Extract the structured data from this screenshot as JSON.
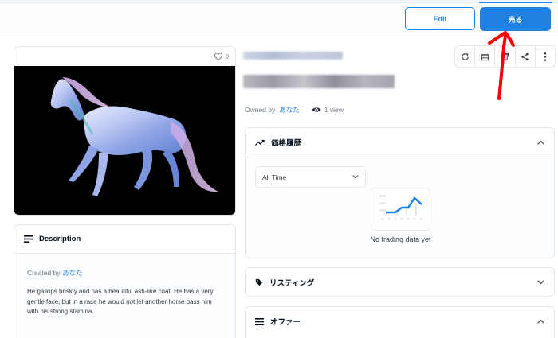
{
  "actions": {
    "edit_label": "Edit",
    "sell_label": "売る"
  },
  "item": {
    "favorites": "0",
    "owned_prefix": "Owned by",
    "owner": "あなた",
    "views": "1 view"
  },
  "description": {
    "header": "Description",
    "created_prefix": "Created by",
    "creator": "あなた",
    "text": "He gallops briskly and has a beautiful ash-like coat. He has a very gentle face, but in a race he would not let another horse pass him with his strong stamina."
  },
  "price_history": {
    "header": "価格履歴",
    "period": "All Time",
    "empty_text": "No trading data yet"
  },
  "listing": {
    "header": "リスティング"
  },
  "offers": {
    "header": "オファー"
  },
  "icons": [
    "heart-icon",
    "refresh-icon",
    "gift-icon",
    "external-link-icon",
    "share-icon",
    "more-icon",
    "chart-line-icon",
    "tag-icon",
    "list-icon",
    "eye-icon",
    "description-icon",
    "chevron-down-icon",
    "chevron-up-icon"
  ],
  "colors": {
    "accent": "#2081e2",
    "text": "#353840",
    "muted": "#707a83",
    "border": "#e5e8eb",
    "annotation": "#ff0000"
  }
}
